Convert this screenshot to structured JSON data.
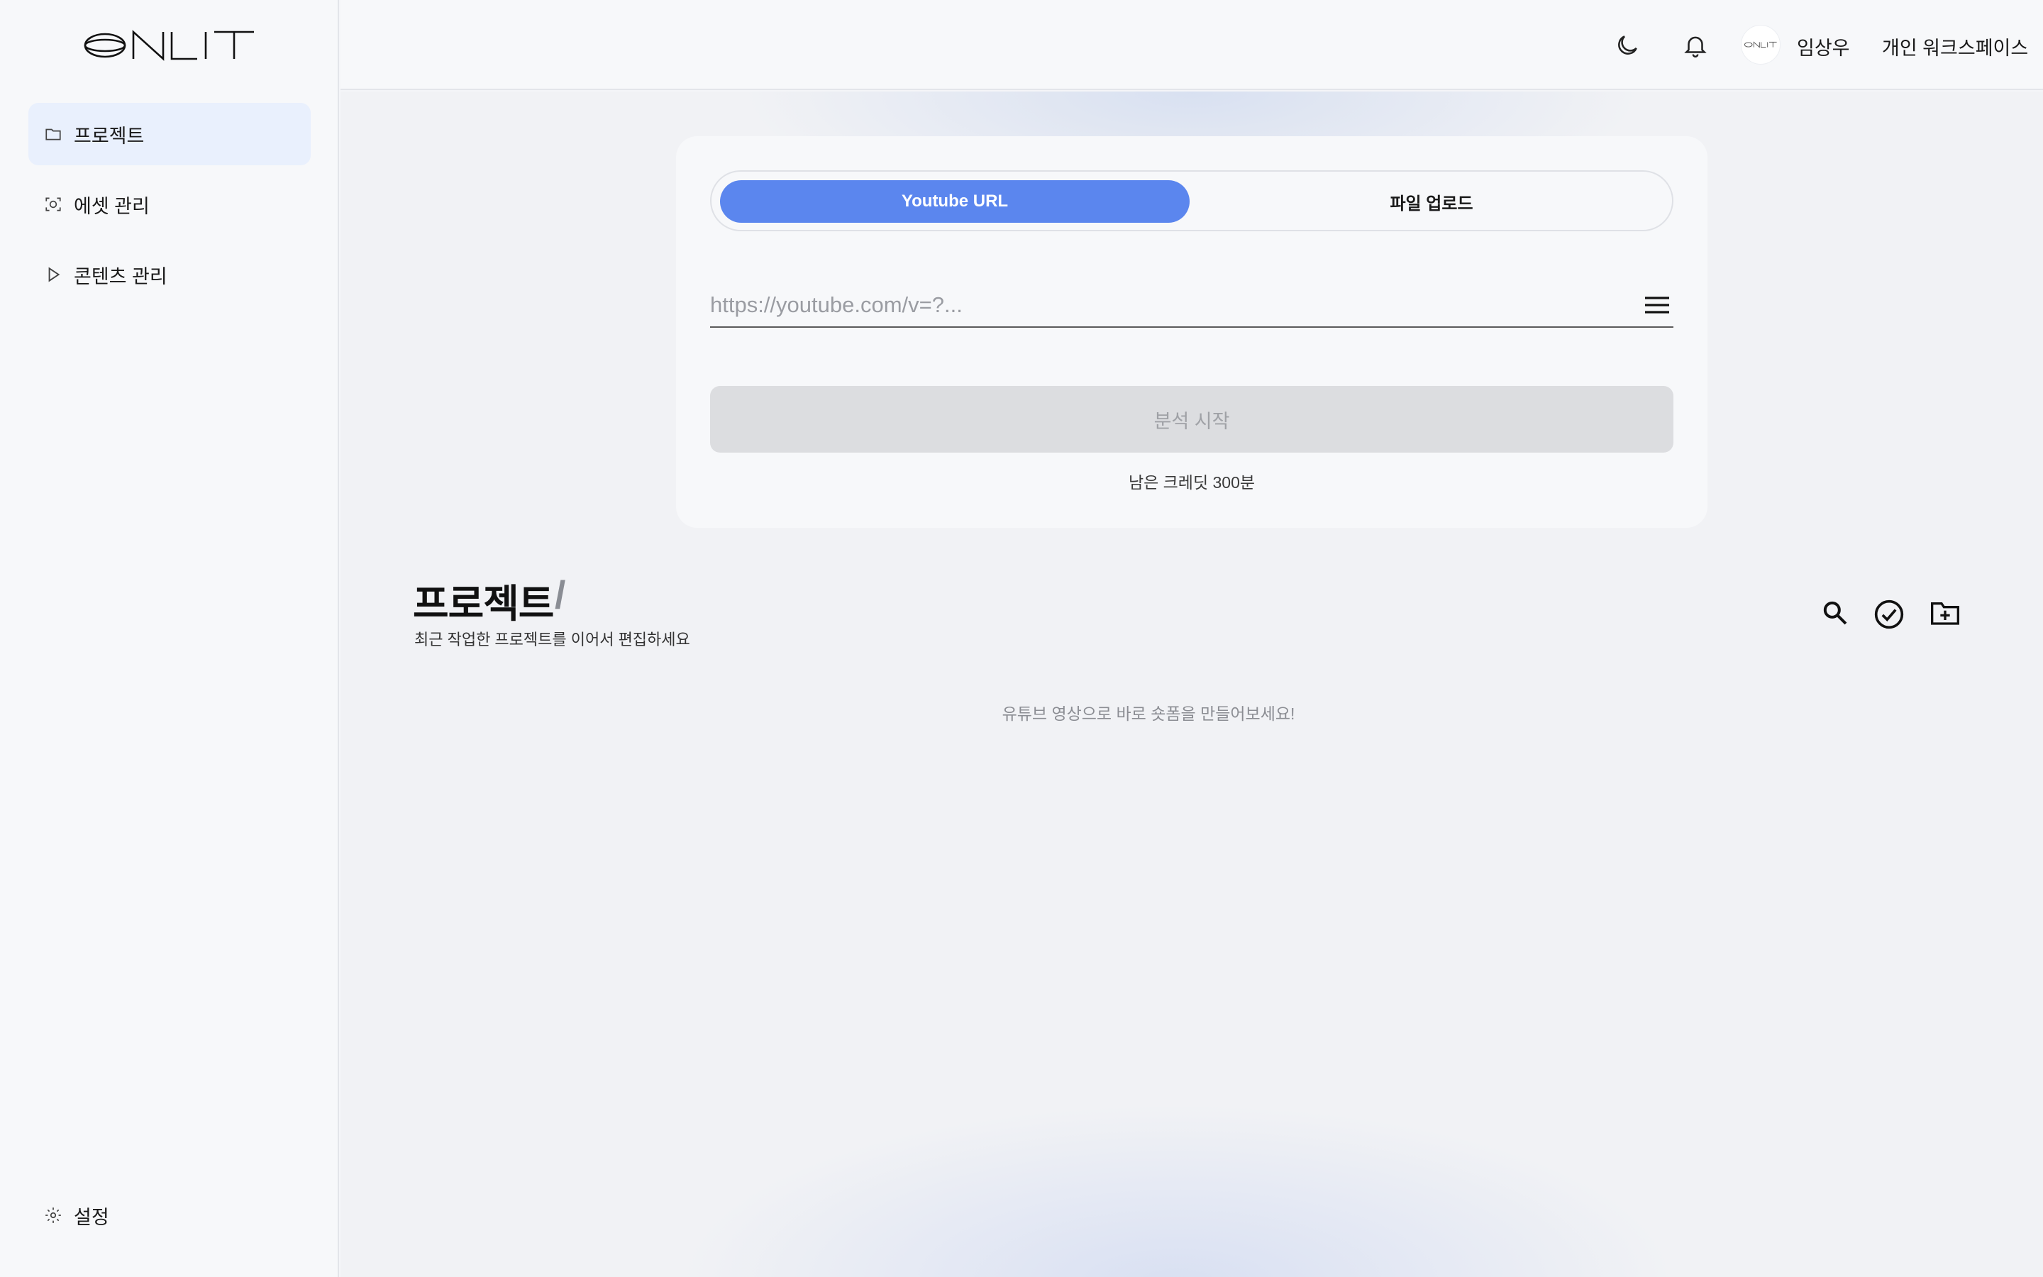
{
  "sidebar": {
    "items": [
      {
        "label": "프로젝트",
        "icon": "folder-icon",
        "active": true
      },
      {
        "label": "에셋 관리",
        "icon": "asset-scan-icon",
        "active": false
      },
      {
        "label": "콘텐츠 관리",
        "icon": "play-icon",
        "active": false
      }
    ],
    "settings_label": "설정"
  },
  "header": {
    "user_name": "임상우",
    "workspace": "개인 워크스페이스"
  },
  "upload_card": {
    "tabs": [
      {
        "label": "Youtube URL",
        "selected": true
      },
      {
        "label": "파일 업로드",
        "selected": false
      }
    ],
    "url_value": "",
    "url_placeholder": "https://youtube.com/v=?...",
    "analyze_label": "분석 시작",
    "credits_text": "남은 크레딧 300분"
  },
  "projects": {
    "title": "프로젝트",
    "slash": "/",
    "subtitle": "최근 작업한 프로젝트를 이어서 편집하세요",
    "empty_message": "유튜브 영상으로 바로 숏폼을 만들어보세요!"
  },
  "colors": {
    "accent": "#5b86ee",
    "active_nav_bg": "#e9f0fd",
    "disabled_button_bg": "#dcdde0"
  }
}
